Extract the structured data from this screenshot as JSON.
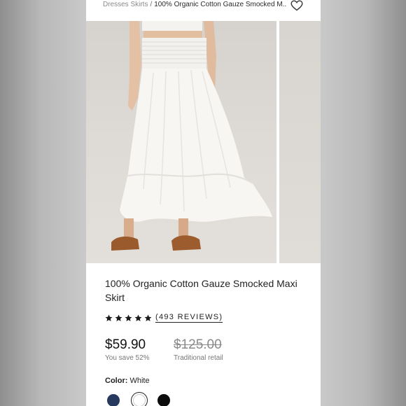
{
  "breadcrumb": {
    "items": [
      "Dresses Skirts"
    ],
    "separator": "/",
    "current": "100% Organic Cotton Gauze Smocked M..."
  },
  "icons": {
    "wishlist": "heart-outline-icon",
    "rating": "star-icon"
  },
  "product": {
    "title": "100% Organic Cotton Gauze Smocked Maxi Skirt",
    "rating_stars": 5,
    "reviews_label": "(493 REVIEWS)",
    "price": "$59.90",
    "savings": "You save 52%",
    "retail_price": "$125.00",
    "retail_label": "Traditional retail"
  },
  "color": {
    "label": "Color:",
    "selected": "White",
    "swatches": [
      {
        "name": "Navy",
        "hex": "#27395f"
      },
      {
        "name": "White",
        "hex": "#ffffff"
      },
      {
        "name": "Black",
        "hex": "#0c0c0c"
      }
    ]
  }
}
